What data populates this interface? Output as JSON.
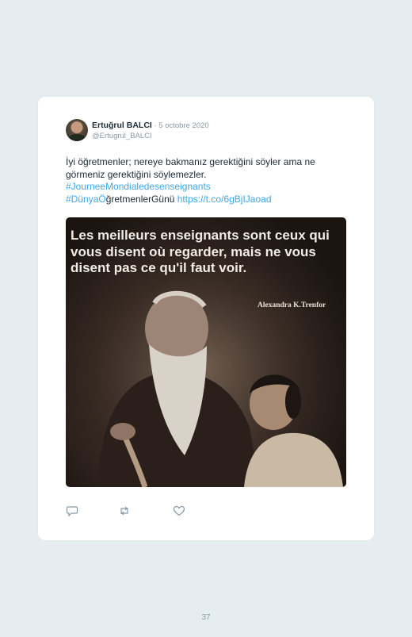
{
  "tweet": {
    "author_name": "Ertuğrul BALCI",
    "separator": " · ",
    "date": "5 octobre 2020",
    "handle": "@Ertugrul_BALCI",
    "text_line_1": "İyi öğretmenler; nereye bakmanız gerektiğini söyler ama ne",
    "text_line_2": "görmeniz gerektiğini söylemezler.",
    "hashtag_1": "#JourneeMondialedesenseignants",
    "hashtag_2": "#DünyaÖ",
    "text_continuation": "ğretmenlerGünü ",
    "link": "https://t.co/6gBjIJaoad"
  },
  "image": {
    "quote": "Les meilleurs enseignants sont ceux qui vous disent où regarder, mais ne vous disent pas ce qu'il faut voir.",
    "quote_author": "Alexandra K.Trenfor"
  },
  "actions": {
    "reply_icon": "reply-icon",
    "retweet_icon": "retweet-icon",
    "like_icon": "heart-icon",
    "color": "#8899a6"
  },
  "page": {
    "number": "37"
  }
}
